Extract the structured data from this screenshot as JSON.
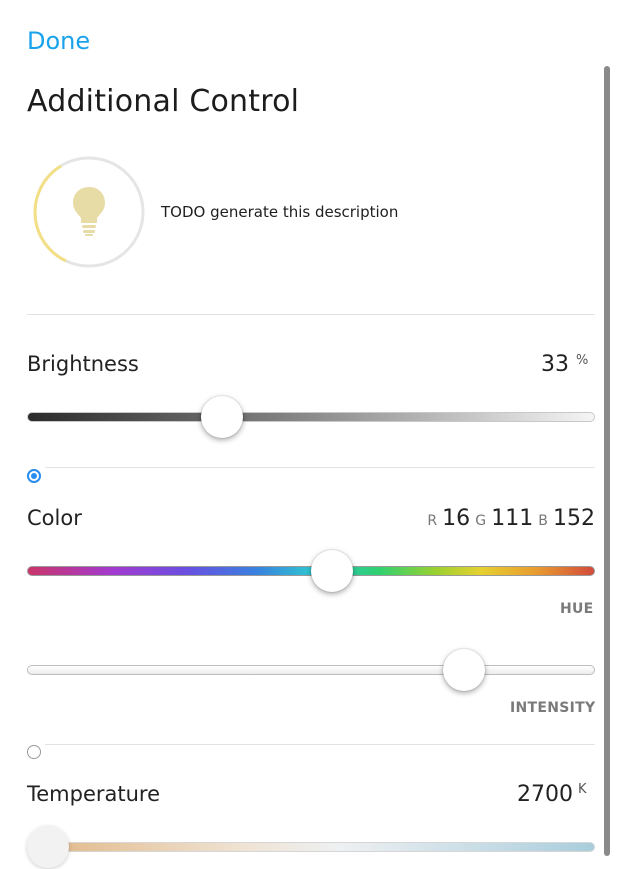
{
  "header": {
    "done_label": "Done",
    "title": "Additional Control"
  },
  "accessory": {
    "description": "TODO generate this description",
    "icon": "lightbulb-icon"
  },
  "brightness": {
    "label": "Brightness",
    "value": "33",
    "unit": "%",
    "level_fraction": 0.33
  },
  "color": {
    "label": "Color",
    "r_label": "R",
    "r_value": "16",
    "g_label": "G",
    "g_value": "111",
    "b_label": "B",
    "b_value": "152",
    "hue_caption": "HUE",
    "intensity_caption": "INTENSITY",
    "hue_fraction": 0.54,
    "intensity_fraction": 0.79,
    "radio_selected": true
  },
  "temperature": {
    "label": "Temperature",
    "value": "2700",
    "unit": "K",
    "level_fraction": 0.0,
    "radio_selected": false
  },
  "colors": {
    "accent": "#1aa3ec",
    "radio": "#2a8cf0",
    "bulb": "#e8dca6",
    "ring": "#f2df86"
  }
}
